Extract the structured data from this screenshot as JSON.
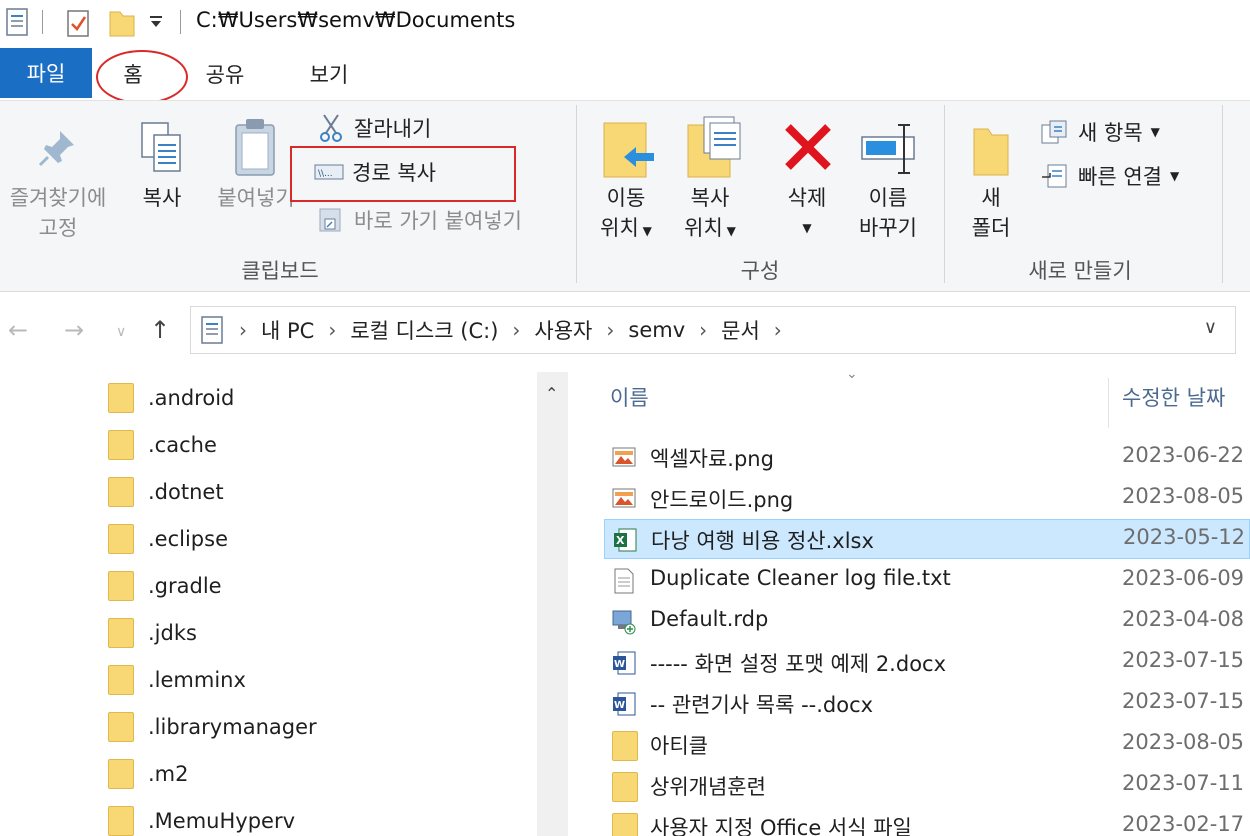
{
  "window": {
    "title": "C:₩Users₩semv₩Documents"
  },
  "ribbon_tabs": [
    {
      "label": "파일"
    },
    {
      "label": "홈"
    },
    {
      "label": "공유"
    },
    {
      "label": "보기"
    }
  ],
  "clipboard": {
    "pin_label_1": "즐겨찾기에",
    "pin_label_2": "고정",
    "copy_label": "복사",
    "paste_label": "붙여넣기",
    "cut_label": "잘라내기",
    "copy_path_label": "경로 복사",
    "paste_shortcut_label": "바로 가기 붙여넣기",
    "group_label": "클립보드"
  },
  "organize": {
    "move_label_1": "이동",
    "move_label_2": "위치",
    "copyto_label_1": "복사",
    "copyto_label_2": "위치",
    "delete_label": "삭제",
    "rename_label_1": "이름",
    "rename_label_2": "바꾸기",
    "group_label": "구성"
  },
  "new": {
    "new_folder_label_1": "새",
    "new_folder_label_2": "폴더",
    "new_item_label": "새 항목",
    "easy_access_label": "빠른 연결",
    "group_label": "새로 만들기"
  },
  "address": {
    "crumbs": [
      "내 PC",
      "로컬 디스크 (C:)",
      "사용자",
      "semv",
      "문서"
    ]
  },
  "nav_folders": [
    ".android",
    ".cache",
    ".dotnet",
    ".eclipse",
    ".gradle",
    ".jdks",
    ".lemminx",
    ".librarymanager",
    ".m2",
    ".MemuHyperv"
  ],
  "file_list": {
    "columns": {
      "name": "이름",
      "modified": "수정한 날짜"
    },
    "rows": [
      {
        "name": "엑셀자료.png",
        "date": "2023-06-22",
        "icon": "image-icon"
      },
      {
        "name": "안드로이드.png",
        "date": "2023-08-05",
        "icon": "image-icon"
      },
      {
        "name": "다낭 여행 비용 정산.xlsx",
        "date": "2023-05-12",
        "icon": "excel-icon",
        "selected": true
      },
      {
        "name": "Duplicate Cleaner log file.txt",
        "date": "2023-06-09",
        "icon": "text-file-icon"
      },
      {
        "name": "Default.rdp",
        "date": "2023-04-08",
        "icon": "rdp-icon"
      },
      {
        "name": "----- 화면 설정 포맷 예제 2.docx",
        "date": "2023-07-15",
        "icon": "word-icon"
      },
      {
        "name": "-- 관련기사 목록 --.docx",
        "date": "2023-07-15",
        "icon": "word-icon"
      },
      {
        "name": "아티클",
        "date": "2023-08-05",
        "icon": "folder-icon"
      },
      {
        "name": "상위개념훈련",
        "date": "2023-07-11",
        "icon": "folder-icon"
      },
      {
        "name": "사용자 지정 Office 서식 파일",
        "date": "2023-02-17",
        "icon": "folder-icon"
      }
    ]
  }
}
